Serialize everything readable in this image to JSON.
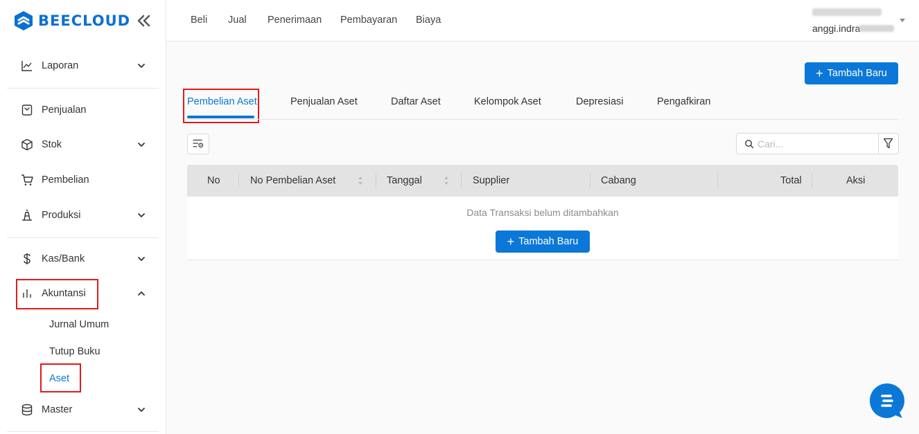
{
  "app": {
    "brand": "BEECLOUD"
  },
  "sidebar": {
    "items": [
      {
        "label": "Laporan"
      },
      {
        "label": "Penjualan"
      },
      {
        "label": "Stok"
      },
      {
        "label": "Pembelian"
      },
      {
        "label": "Produksi"
      },
      {
        "label": "Kas/Bank"
      },
      {
        "label": "Akuntansi"
      },
      {
        "label": "Master"
      }
    ],
    "akuntansi_sub": [
      {
        "label": "Jurnal Umum"
      },
      {
        "label": "Tutup Buku"
      },
      {
        "label": "Aset"
      }
    ]
  },
  "topbar": {
    "nav": [
      "Beli",
      "Jual",
      "Penerimaan",
      "Pembayaran",
      "Biaya"
    ],
    "user_email": "anggi.indra"
  },
  "main": {
    "add_button": "Tambah Baru",
    "tabs": [
      "Pembelian Aset",
      "Penjualan Aset",
      "Daftar Aset",
      "Kelompok Aset",
      "Depresiasi",
      "Pengafkiran"
    ],
    "search_placeholder": "Cari...",
    "table": {
      "columns": [
        "No",
        "No Pembelian Aset",
        "Tanggal",
        "Supplier",
        "Cabang",
        "Total",
        "Aksi"
      ],
      "empty_text": "Data Transaksi belum ditambahkan",
      "empty_add_button": "Tambah Baru"
    }
  },
  "colors": {
    "primary": "#0b78d8",
    "highlight": "#e01b1b"
  }
}
